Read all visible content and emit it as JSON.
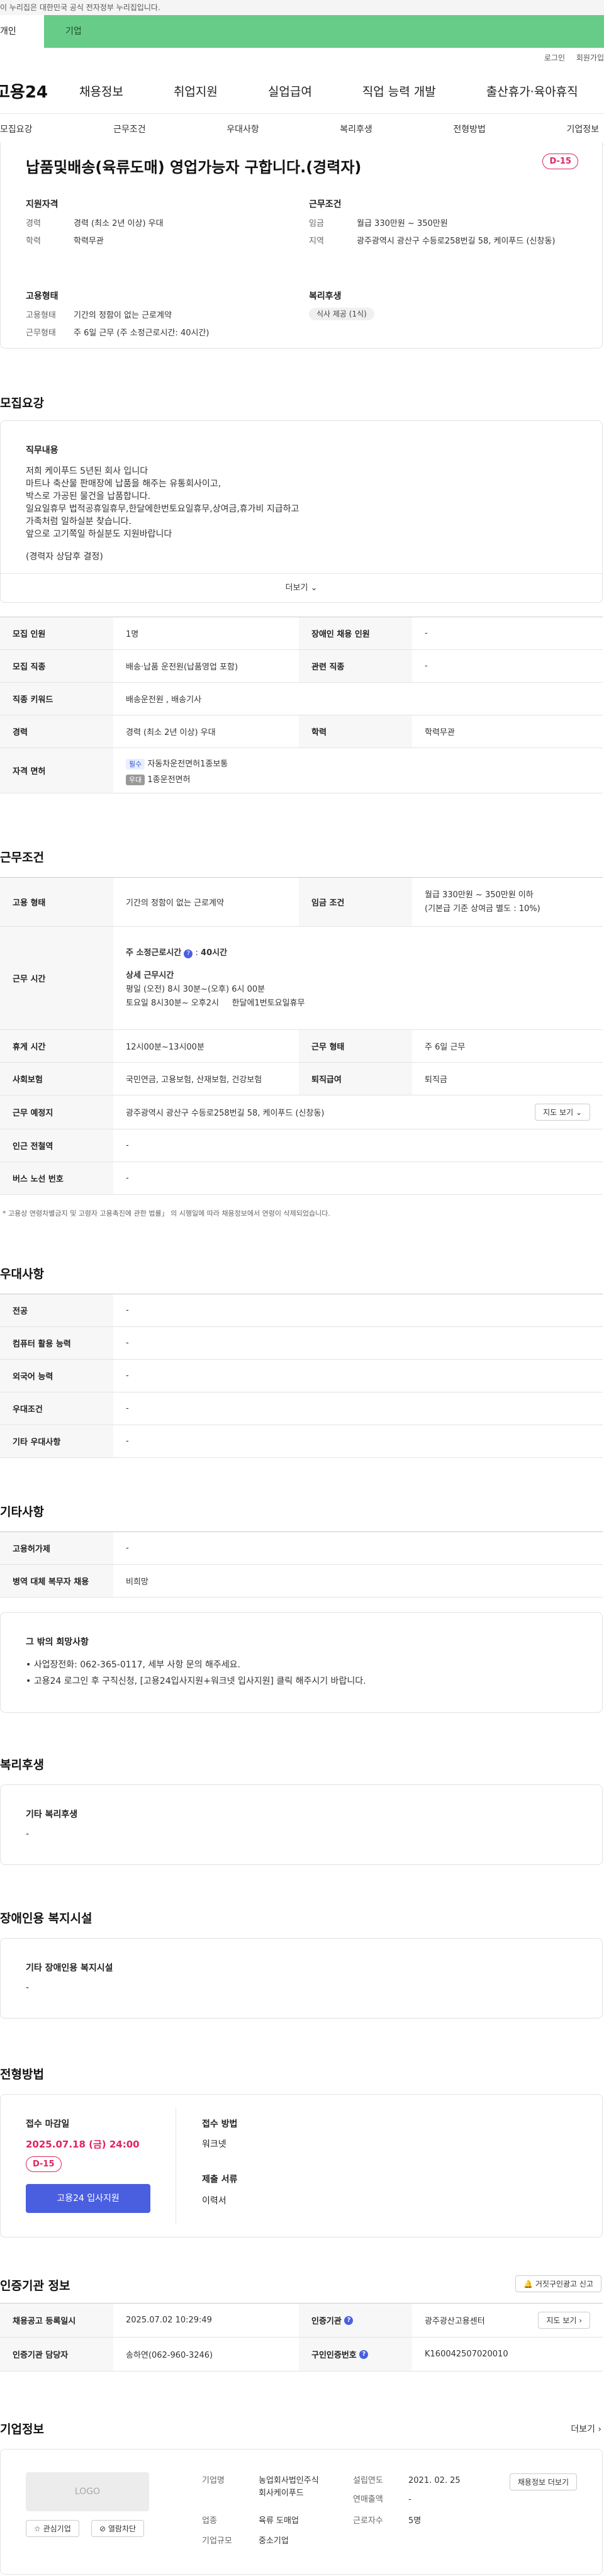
{
  "gov_banner": "이 누리집은 대한민국 공식 전자정부 누리집입니다.",
  "tabs": {
    "personal": "개인",
    "business": "기업"
  },
  "util": {
    "login": "로그인",
    "join": "회원가입"
  },
  "gnb": {
    "logo": "고용24",
    "menus": [
      "채용정보",
      "취업지원",
      "실업급여",
      "직업 능력 개발",
      "출산휴가·육아휴직"
    ]
  },
  "subnav": [
    "모집요강",
    "근무조건",
    "우대사항",
    "복리후생",
    "전형방법",
    "기업정보"
  ],
  "summary": {
    "title": "납품및배송(육류도매) 영업가능자 구합니다.(경력자)",
    "dday": "D-15",
    "qual_h": "지원자격",
    "career_k": "경력",
    "career_v": "경력 (최소 2년 이상) 우대",
    "edu_k": "학력",
    "edu_v": "학력무관",
    "cond_h": "근무조건",
    "wage_k": "임금",
    "wage_v": "월급 330만원 ~ 350만원",
    "loc_k": "지역",
    "loc_v": "광주광역시 광산구 수등로258번길 58, 케이푸드 (신창동)",
    "emp_h": "고용형태",
    "type_k": "고용형태",
    "type_v": "기간의 정함이 없는 근로계약",
    "work_k": "근무형태",
    "work_v": "주 6일 근무 (주 소정근로시간: 40시간)",
    "welfare_h": "복리후생",
    "welfare_chip": "식사 제공 (1식)"
  },
  "recruit": {
    "section": "모집요강",
    "job_h": "직무내용",
    "job_lines": [
      "저희 케이푸드 5년된 회사 입니다",
      "마트나 축산물 판매장에 납품을 해주는 유통회사이고,",
      "박스로 가공된 물건을 납품합니다.",
      "일요일휴무 법적공휴일휴무,한달에한번토요일휴무,상여금,휴가비 지급하고",
      "가족처럼 일하실분 찾습니다.",
      "앞으로 고기쪽일 하실분도 지원바랍니다",
      "(경력자 상담후 결정)"
    ],
    "more": "더보기",
    "rows": [
      [
        "모집 인원",
        "1명",
        "장애인 채용 인원",
        "-"
      ],
      [
        "모집 직종",
        "배송·납품 운전원(납품영업 포함)",
        "관련 직종",
        "-"
      ],
      [
        "직종 키워드",
        "배송운전원 , 배송기사",
        "",
        ""
      ],
      [
        "경력",
        "경력 (최소 2년 이상) 우대",
        "학력",
        "학력무관"
      ]
    ],
    "license_h": "자격 면허",
    "lic1_tag": "필수",
    "lic1": "자동차운전면허1종보통",
    "lic2_tag": "우대",
    "lic2": "1종운전면허"
  },
  "work": {
    "section": "근무조건",
    "emp_h": "고용 형태",
    "emp_v": "기간의 정함이 없는 근로계약",
    "wage_h": "임금 조건",
    "wage_v1": "월급 330만원 ~ 350만원 이하",
    "wage_v2": "(기본급 기준 상여금 별도 : 10%)",
    "time_h": "근무 시간",
    "week_h": "주 소정근로시간",
    "week_v": "40시간",
    "detail_h": "상세 근무시간",
    "detail1": "평일 (오전) 8시 30분~(오후) 6시 00분",
    "detail2": "토요일 8시30분~ 오후2시     한달에1번토요일휴무",
    "rest_h": "휴게 시간",
    "rest_v": "12시00분~13시00분",
    "wtype_h": "근무 형태",
    "wtype_v": "주 6일 근무",
    "ins_h": "사회보험",
    "ins_v": "국민연금, 고용보험, 산재보험, 건강보험",
    "ret_h": "퇴직급여",
    "ret_v": "퇴직금",
    "place_h": "근무 예정지",
    "place_v": "광주광역시 광산구 수등로258번길 58, 케이푸드 (신창동)",
    "map_btn": "지도 보기",
    "subway_h": "인근 전철역",
    "subway_v": "-",
    "bus_h": "버스 노선 번호",
    "bus_v": "-",
    "note": "* 고용상 연령차별금지 및 고령자 고용촉진에 관한 법률」 의 시행일에 따라 채용정보에서 연령이 삭제되었습니다."
  },
  "pref": {
    "section": "우대사항",
    "rows": [
      [
        "전공",
        "-"
      ],
      [
        "컴퓨터 활용 능력",
        "-"
      ],
      [
        "외국어 능력",
        "-"
      ],
      [
        "우대조건",
        "-"
      ],
      [
        "기타 우대사항",
        "-"
      ]
    ]
  },
  "etc": {
    "section": "기타사항",
    "rows": [
      [
        "고용허가제",
        "-"
      ],
      [
        "병역 대체 복무자 채용",
        "비희망"
      ]
    ],
    "wish_h": "그 밖의 희망사항",
    "wish1": "• 사업장전화: 062-365-0117, 세부 사항 문의 해주세요.",
    "wish2": "• 고용24 로그인 후 구직신청, [고용24입사지원+워크넷 입사지원] 클릭 해주시기 바랍니다."
  },
  "welfare": {
    "section": "복리후생",
    "h": "기타 복리후생",
    "v": "-"
  },
  "disabled": {
    "section": "장애인용 복지시설",
    "h": "기타 장애인용 복지시설",
    "v": "-"
  },
  "process": {
    "section": "전형방법",
    "deadline_h": "접수 마감일",
    "deadline_v": "2025.07.18 (금) 24:00",
    "dday": "D-15",
    "apply_btn": "고용24 입사지원",
    "method_h": "접수 방법",
    "method_v": "워크넷",
    "docs_h": "제출 서류",
    "docs_v": "이력서"
  },
  "cert": {
    "section": "인증기관 정보",
    "report_btn": "거짓구인광고 신고",
    "reg_h": "채용공고 등록일시",
    "reg_v": "2025.07.02 10:29:49",
    "org_h": "인증기관",
    "org_v": "광주광산고용센터",
    "mgr_h": "인증기관 담당자",
    "mgr_v": "송하연(062-960-3246)",
    "id_h": "구인인증번호",
    "id_v": "K160042507020010",
    "map_btn": "지도 보기"
  },
  "company": {
    "section": "기업정보",
    "more": "더보기",
    "logo": "LOGO",
    "fav_btn": "관심기업",
    "block_btn": "열람차단",
    "name_h": "기업명",
    "name_v1": "농업회사법인주식",
    "name_v2": "회사케이푸드",
    "est_h": "설립연도",
    "est_v": "2021. 02. 25",
    "sales_h": "연매출액",
    "sales_v": "-",
    "ind_h": "업종",
    "ind_v": "육류 도매업",
    "emp_h": "근로자수",
    "emp_v": "5명",
    "size_h": "기업규모",
    "size_v": "중소기업",
    "jobs_btn": "채용정보 더보기"
  },
  "colors": {
    "accent": "#4a5fe0",
    "dday": "#e0245e",
    "biz_tab": "#66cc88"
  }
}
